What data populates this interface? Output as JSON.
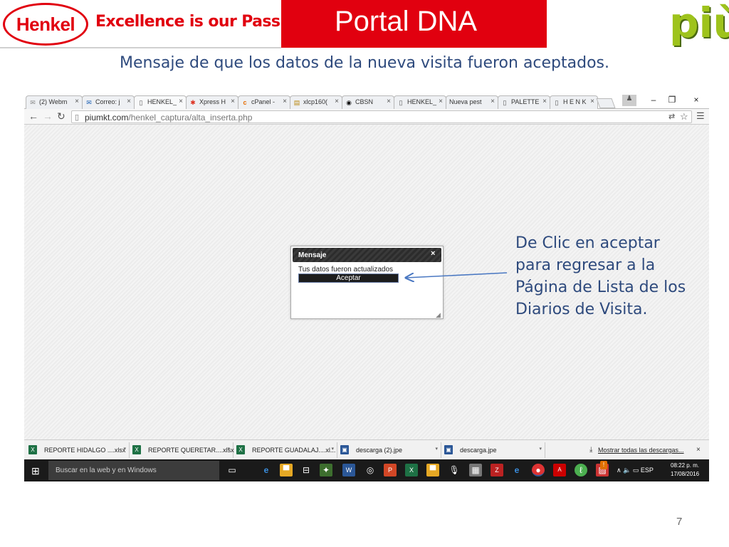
{
  "header": {
    "logo_text": "Henkel",
    "slogan": "Excellence is our Passion",
    "banner_title": "Portal  DNA",
    "brand_right": "più"
  },
  "subtitle": "Mensaje de que los datos de la nueva visita fueron aceptados.",
  "browser": {
    "tabs": [
      {
        "label": "(2) Webm",
        "icon": "mail-icon"
      },
      {
        "label": "Correo: j",
        "icon": "envelope-icon"
      },
      {
        "label": "HENKEL_",
        "icon": "page-icon",
        "active": true
      },
      {
        "label": "Xpress H",
        "icon": "xpress-icon"
      },
      {
        "label": "cPanel -",
        "icon": "cpanel-icon"
      },
      {
        "label": "xlcp160(",
        "icon": "chart-icon"
      },
      {
        "label": "CBSN",
        "icon": "cbs-icon"
      },
      {
        "label": "HENKEL_",
        "icon": "page-icon"
      },
      {
        "label": "Nueva pest",
        "icon": ""
      },
      {
        "label": "PALETTE",
        "icon": "page-icon"
      },
      {
        "label": "H E N K",
        "icon": "page-icon"
      }
    ],
    "url_host": "piumkt.com",
    "url_path": "/henkel_captura/alta_inserta.php"
  },
  "dialog": {
    "title": "Mensaje",
    "close": "×",
    "message": "Tus datos fueron actualizados",
    "button": "Aceptar"
  },
  "downloads": {
    "items": [
      {
        "label": "REPORTE HIDALGO ....xlsx",
        "icon": "excel-icon"
      },
      {
        "label": "REPORTE QUERETAR....xlsx",
        "icon": "excel-icon"
      },
      {
        "label": "REPORTE GUADALAJ....xl...",
        "icon": "excel-icon"
      },
      {
        "label": "descarga (2).jpe",
        "icon": "image-icon"
      },
      {
        "label": "descarga.jpe",
        "icon": "image-icon"
      }
    ],
    "show_all": "Mostrar todas las descargas...",
    "close": "×"
  },
  "taskbar": {
    "search_placeholder": "Buscar en la web y en Windows",
    "language": "ESP",
    "time": "08:22 p. m.",
    "date": "17/08/2016"
  },
  "callout": "De Clic en aceptar para regresar a la Página  de Lista de los Diarios de Visita.",
  "page_number": "7",
  "colors": {
    "henkel_red": "#e1000f",
    "text_blue": "#2e4a7d",
    "piu_green": "#9ec31c"
  }
}
